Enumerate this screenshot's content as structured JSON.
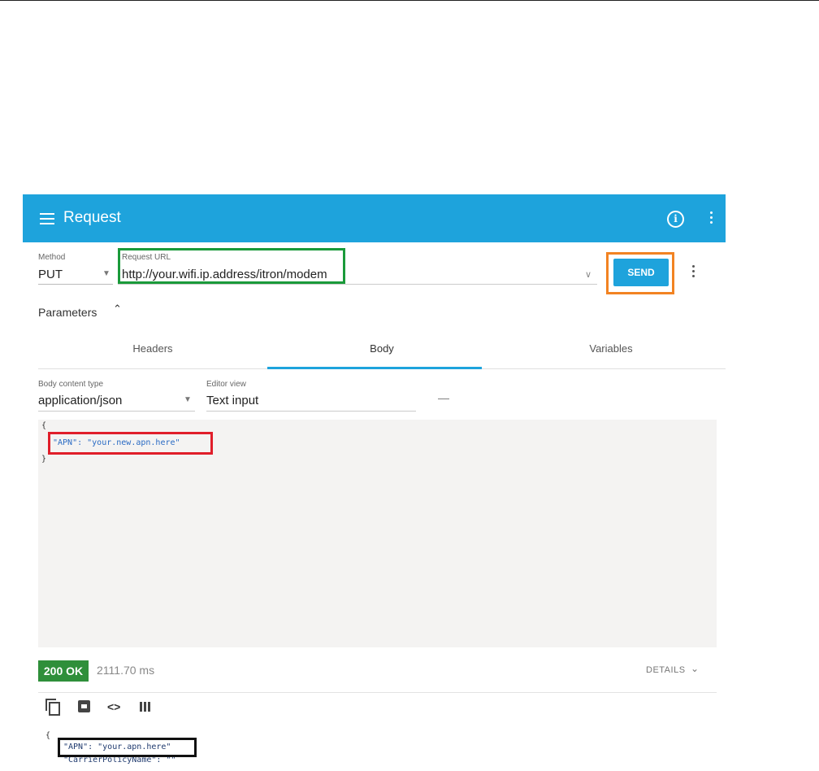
{
  "header": {
    "title": "Request"
  },
  "request": {
    "method_label": "Method",
    "method_value": "PUT",
    "url_label": "Request URL",
    "url_value": "http://your.wifi.ip.address/itron/modem",
    "send_label": "SEND"
  },
  "parameters": {
    "label": "Parameters"
  },
  "tabs": [
    {
      "label": "Headers"
    },
    {
      "label": "Body"
    },
    {
      "label": "Variables"
    }
  ],
  "body": {
    "content_type_label": "Body content type",
    "content_type_value": "application/json",
    "editor_view_label": "Editor view",
    "editor_view_value": "Text input",
    "editor_lines": [
      "{",
      "\"APN\": \"your.new.apn.here\"",
      "}"
    ]
  },
  "response": {
    "status": "200 OK",
    "time": "2111.70 ms",
    "details_label": "DETAILS",
    "lines": [
      "{",
      "\"APN\": \"your.apn.here\"",
      "\"CarrierPolicyName\": \"\""
    ]
  },
  "colors": {
    "appbar": "#1ea3dc",
    "status_ok": "#2f8f3a",
    "highlight_url": "#1a9a3a",
    "highlight_send": "#f28322",
    "highlight_body": "#e01e2a",
    "highlight_response": "#111111"
  },
  "icons": [
    "menu-icon",
    "info-icon",
    "more-vert-icon",
    "chevron-down-icon",
    "chevron-up-icon",
    "copy-icon",
    "save-icon",
    "code-icon",
    "columns-icon"
  ]
}
